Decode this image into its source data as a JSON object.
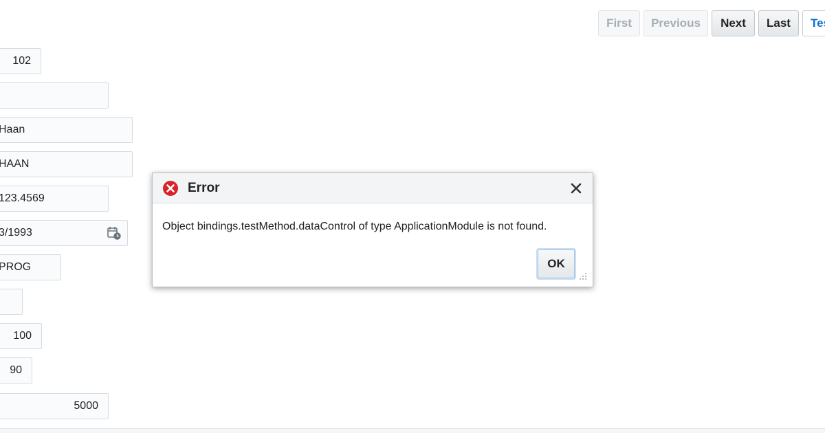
{
  "toolbar": {
    "first_label": "First",
    "previous_label": "Previous",
    "next_label": "Next",
    "last_label": "Last",
    "test_label": "Tes"
  },
  "form": {
    "fields": [
      {
        "value": "102"
      },
      {
        "value": ""
      },
      {
        "value": "Haan"
      },
      {
        "value": "HAAN"
      },
      {
        "value": "123.4569"
      },
      {
        "value": "3/1993"
      },
      {
        "value": "PROG"
      },
      {
        "value": ""
      },
      {
        "value": "100"
      },
      {
        "value": "90"
      },
      {
        "value": "5000"
      }
    ]
  },
  "dialog": {
    "title": "Error",
    "message": "Object bindings.testMethod.dataControl of type ApplicationModule is not found.",
    "ok_label": "OK"
  },
  "colors": {
    "error_red": "#d8232a",
    "link_blue": "#0b6ed0",
    "focus_ring": "#c9dff5"
  },
  "icons": {
    "error": "error-circle-x-icon",
    "close": "close-icon",
    "date": "calendar-time-icon",
    "resize": "resize-grip-icon"
  }
}
